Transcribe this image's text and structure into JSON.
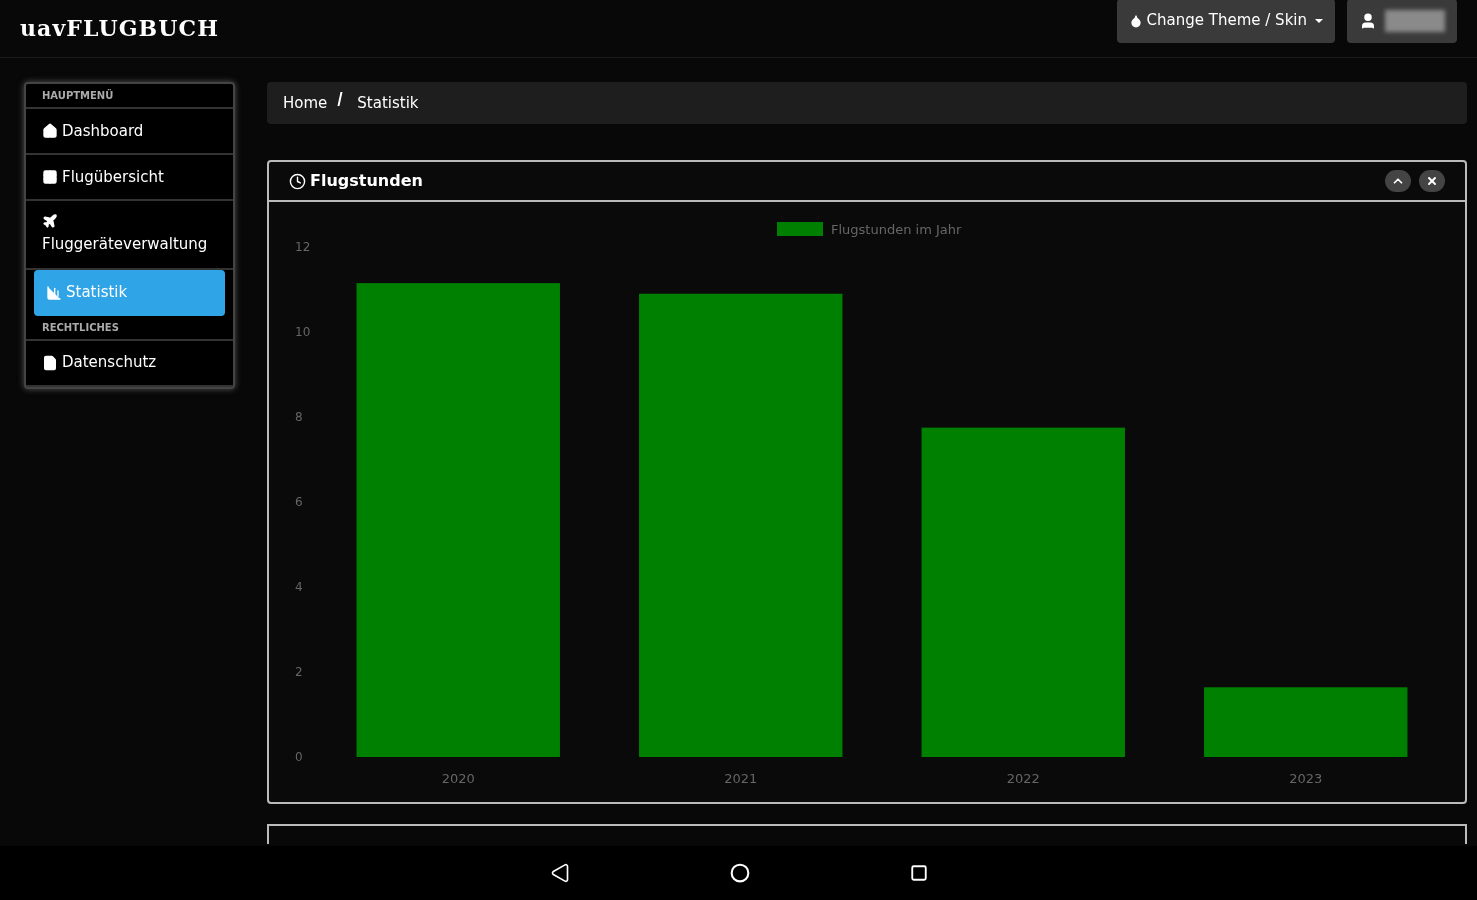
{
  "header": {
    "logo": "uavFLUGBUCH",
    "theme_button": "Change Theme / Skin"
  },
  "sidebar": {
    "items": [
      {
        "kind": "heading",
        "label": "HAUPTMENÜ"
      },
      {
        "kind": "link",
        "label": "Dashboard",
        "selected": false
      },
      {
        "kind": "link",
        "label": "Flugübersicht",
        "selected": false
      },
      {
        "kind": "link",
        "label": "Fluggeräteverwaltung",
        "selected": false,
        "stacked": true
      },
      {
        "kind": "link",
        "label": "Statistik",
        "selected": true
      },
      {
        "kind": "heading",
        "label": "RECHTLICHES"
      },
      {
        "kind": "link",
        "label": "Datenschutz",
        "selected": false
      }
    ]
  },
  "breadcrumb": [
    "Home",
    "Statistik"
  ],
  "panel": {
    "title": "Flugstunden",
    "chart_data": {
      "type": "bar",
      "categories": [
        "2020",
        "2021",
        "2022",
        "2023"
      ],
      "series": [
        {
          "name": "Flugstunden im Jahr",
          "color": "#008000",
          "values": [
            11.15,
            10.9,
            7.75,
            1.64
          ]
        }
      ],
      "ylim": [
        0,
        12
      ],
      "yticks": [
        0,
        2,
        4,
        6,
        8,
        10,
        12
      ]
    }
  }
}
